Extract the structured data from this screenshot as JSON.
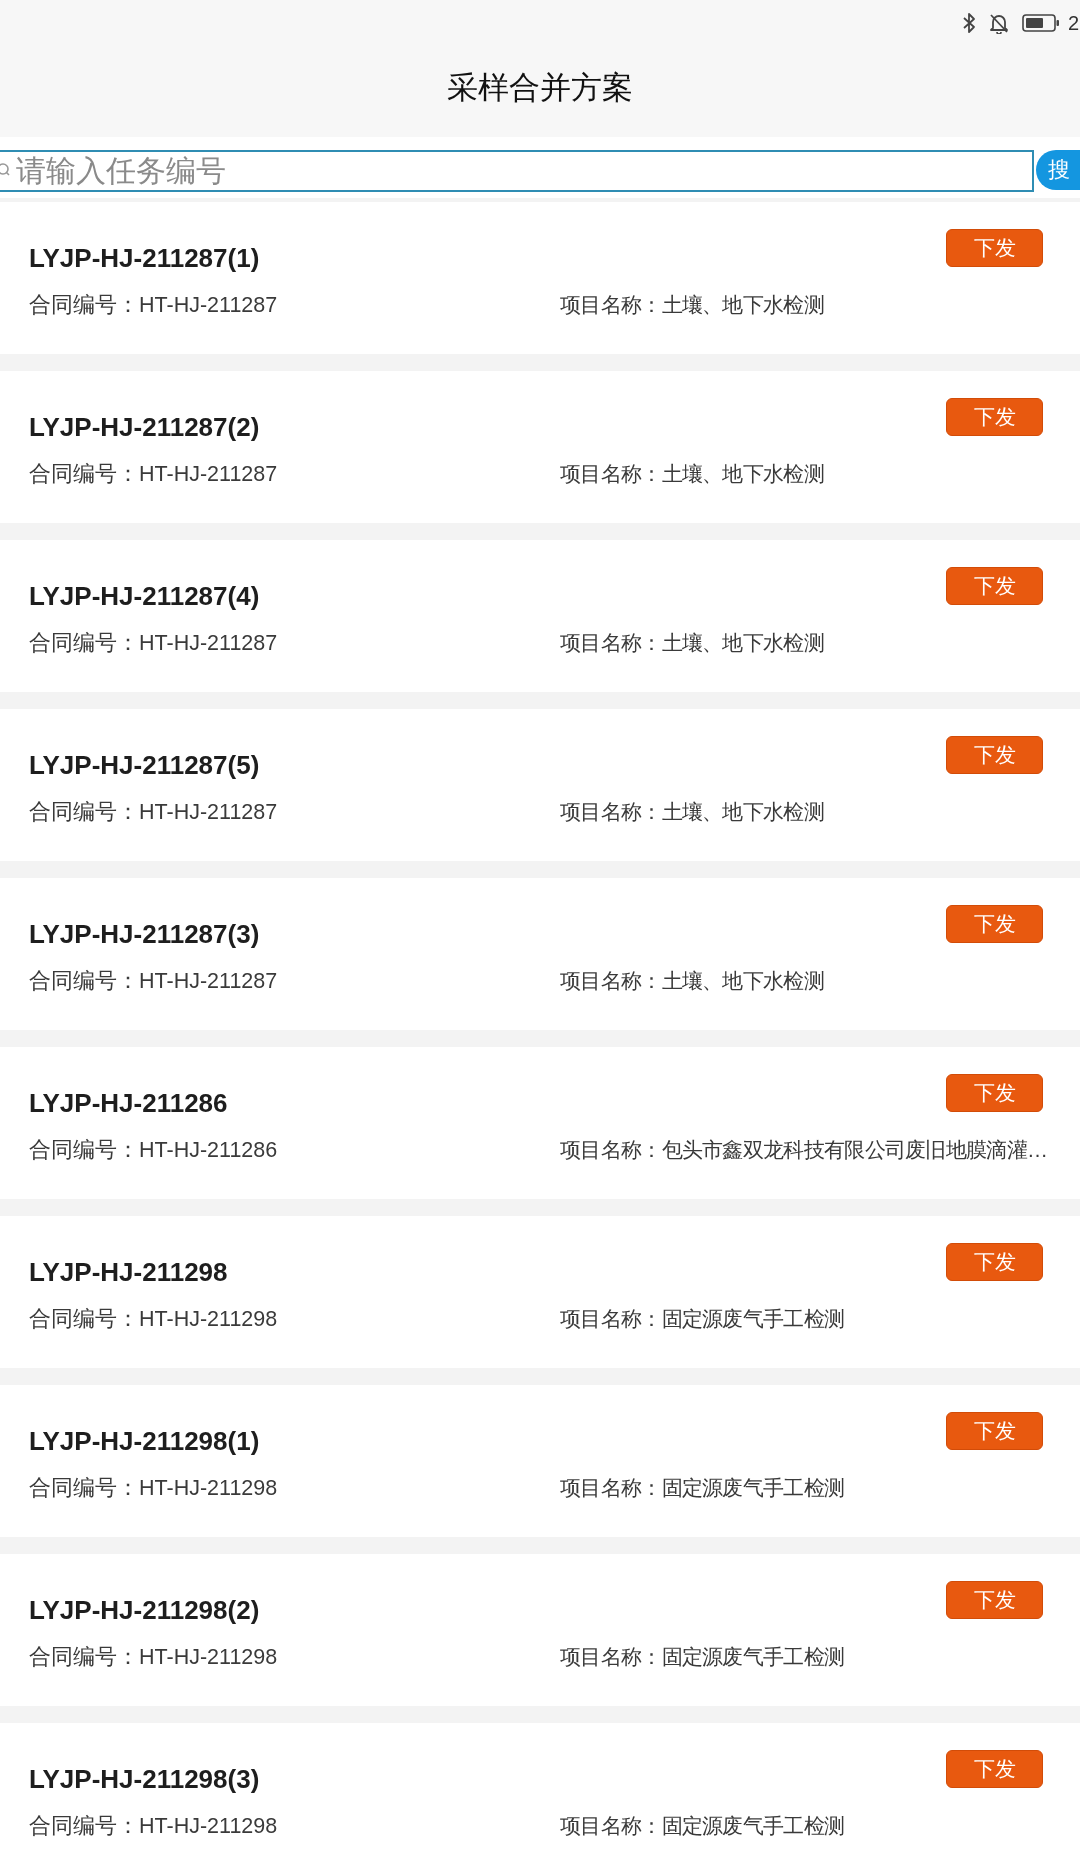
{
  "status_bar": {
    "time": "2"
  },
  "header": {
    "title": "采样合并方案"
  },
  "search": {
    "placeholder": "请输入任务编号",
    "button": "搜"
  },
  "tasks": [
    {
      "title": "LYJP-HJ-211287(1)",
      "contract": "合同编号：HT-HJ-211287",
      "project": "项目名称：土壤、地下水检测",
      "action": "下发"
    },
    {
      "title": "LYJP-HJ-211287(2)",
      "contract": "合同编号：HT-HJ-211287",
      "project": "项目名称：土壤、地下水检测",
      "action": "下发"
    },
    {
      "title": "LYJP-HJ-211287(4)",
      "contract": "合同编号：HT-HJ-211287",
      "project": "项目名称：土壤、地下水检测",
      "action": "下发"
    },
    {
      "title": "LYJP-HJ-211287(5)",
      "contract": "合同编号：HT-HJ-211287",
      "project": "项目名称：土壤、地下水检测",
      "action": "下发"
    },
    {
      "title": "LYJP-HJ-211287(3)",
      "contract": "合同编号：HT-HJ-211287",
      "project": "项目名称：土壤、地下水检测",
      "action": "下发"
    },
    {
      "title": "LYJP-HJ-211286",
      "contract": "合同编号：HT-HJ-211286",
      "project": "项目名称：包头市鑫双龙科技有限公司废旧地膜滴灌…",
      "action": "下发"
    },
    {
      "title": "LYJP-HJ-211298",
      "contract": "合同编号：HT-HJ-211298",
      "project": "项目名称：固定源废气手工检测",
      "action": "下发"
    },
    {
      "title": "LYJP-HJ-211298(1)",
      "contract": "合同编号：HT-HJ-211298",
      "project": "项目名称：固定源废气手工检测",
      "action": "下发"
    },
    {
      "title": "LYJP-HJ-211298(2)",
      "contract": "合同编号：HT-HJ-211298",
      "project": "项目名称：固定源废气手工检测",
      "action": "下发"
    },
    {
      "title": "LYJP-HJ-211298(3)",
      "contract": "合同编号：HT-HJ-211298",
      "project": "项目名称：固定源废气手工检测",
      "action": "下发"
    }
  ]
}
